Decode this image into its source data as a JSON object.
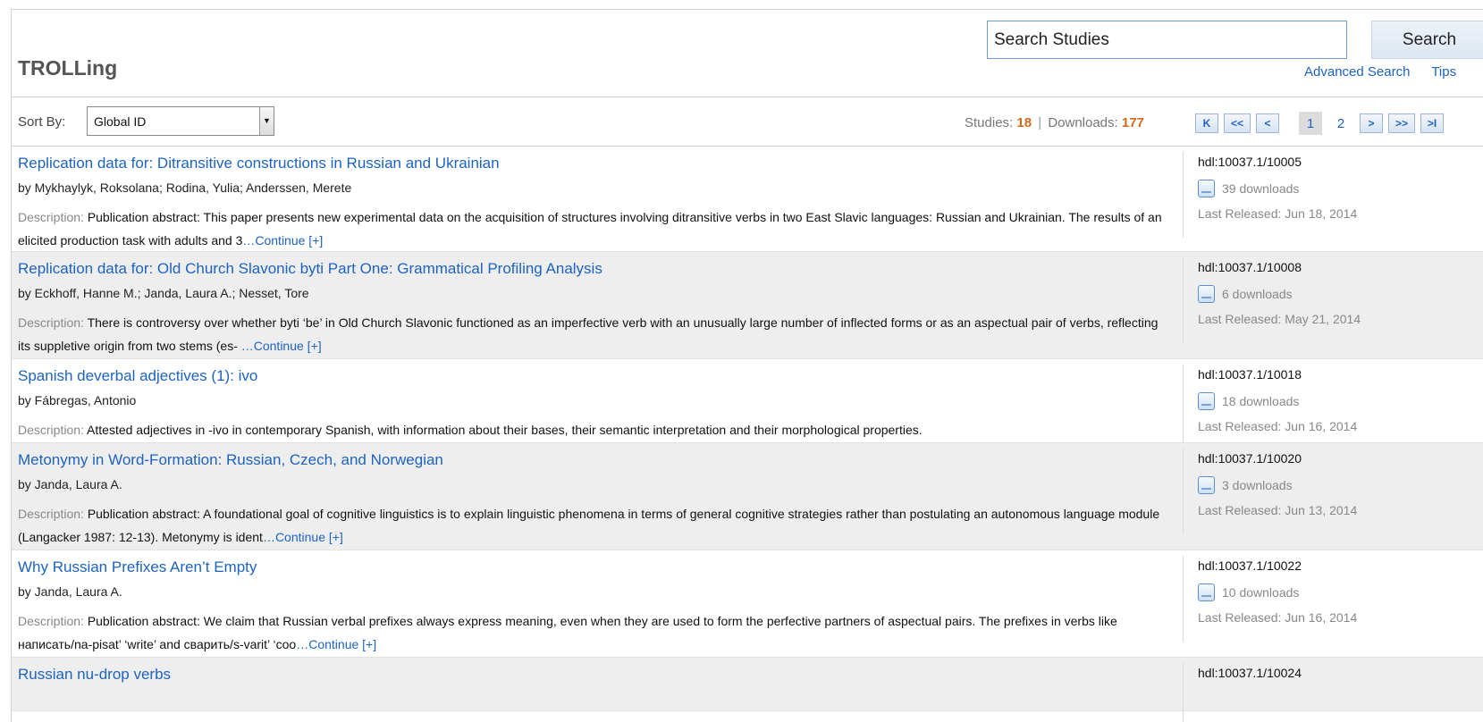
{
  "header": {
    "site_title": "TROLLing",
    "search_value": "Search Studies",
    "search_button": "Search",
    "advanced_search": "Advanced Search",
    "tips": "Tips"
  },
  "toolbar": {
    "sort_label": "Sort By:",
    "sort_value": "Global ID",
    "studies_label": "Studies:",
    "studies_count": "18",
    "separator": "|",
    "downloads_label": "Downloads:",
    "downloads_count": "177"
  },
  "pager": {
    "first": "K",
    "prev_set": "<<",
    "prev": "<",
    "pages": [
      "1",
      "2"
    ],
    "current_page": "1",
    "next": ">",
    "next_set": ">>",
    "last": ">I"
  },
  "studies": [
    {
      "title": "Replication data for: Ditransitive constructions in Russian and Ukrainian",
      "authors": "by Mykhaylyk, Roksolana; Rodina, Yulia; Anderssen, Merete",
      "desc_label": "Description:",
      "description": "Publication abstract: This paper presents new experimental data on the acquisition of structures involving ditransitive verbs in two East Slavic languages: Russian and Ukrainian. The results of an elicited production task with adults and 3",
      "continue": "…Continue [+]",
      "handle": "hdl:10037.1/10005",
      "downloads": "39 downloads",
      "released": "Last Released: Jun 18, 2014"
    },
    {
      "title": "Replication data for: Old Church Slavonic byti Part One: Grammatical Profiling Analysis",
      "authors": "by Eckhoff, Hanne M.; Janda, Laura A.; Nesset, Tore",
      "desc_label": "Description:",
      "description": "There is controversy over whether byti ‘be’ in Old Church Slavonic functioned as an imperfective verb with an unusually large number of inflected forms or as an aspectual pair of verbs, reflecting its suppletive origin from two stems (es- ",
      "continue": "…Continue [+]",
      "handle": "hdl:10037.1/10008",
      "downloads": "6 downloads",
      "released": "Last Released: May 21, 2014"
    },
    {
      "title": "Spanish deverbal adjectives (1): ivo",
      "authors": "by Fábregas, Antonio",
      "desc_label": "Description:",
      "description": "Attested adjectives in -ivo in contemporary Spanish, with information about their bases, their semantic interpretation and their morphological properties.",
      "continue": "",
      "handle": "hdl:10037.1/10018",
      "downloads": "18 downloads",
      "released": "Last Released: Jun 16, 2014"
    },
    {
      "title": "Metonymy in Word-Formation: Russian, Czech, and Norwegian",
      "authors": "by Janda, Laura A.",
      "desc_label": "Description:",
      "description": "Publication abstract: A foundational goal of cognitive linguistics is to explain linguistic phenomena in terms of general cognitive strategies rather than postulating an autonomous language module (Langacker 1987: 12-13). Metonymy is ident",
      "continue": "…Continue [+]",
      "handle": "hdl:10037.1/10020",
      "downloads": "3 downloads",
      "released": "Last Released: Jun 13, 2014"
    },
    {
      "title": "Why Russian Prefixes Aren’t Empty",
      "authors": "by Janda, Laura A.",
      "desc_label": "Description:",
      "description": "Publication abstract: We claim that Russian verbal prefixes always express meaning, even when they are used to form the perfective partners of aspectual pairs. The prefixes in verbs like написать/na-pisat’ ‘write’ and сварить/s-varit’ ‘coo",
      "continue": "…Continue [+]",
      "handle": "hdl:10037.1/10022",
      "downloads": "10 downloads",
      "released": "Last Released: Jun 16, 2014"
    },
    {
      "title": "Russian nu-drop verbs",
      "authors": "",
      "desc_label": "",
      "description": "",
      "continue": "",
      "handle": "hdl:10037.1/10024",
      "downloads": "",
      "released": ""
    }
  ]
}
